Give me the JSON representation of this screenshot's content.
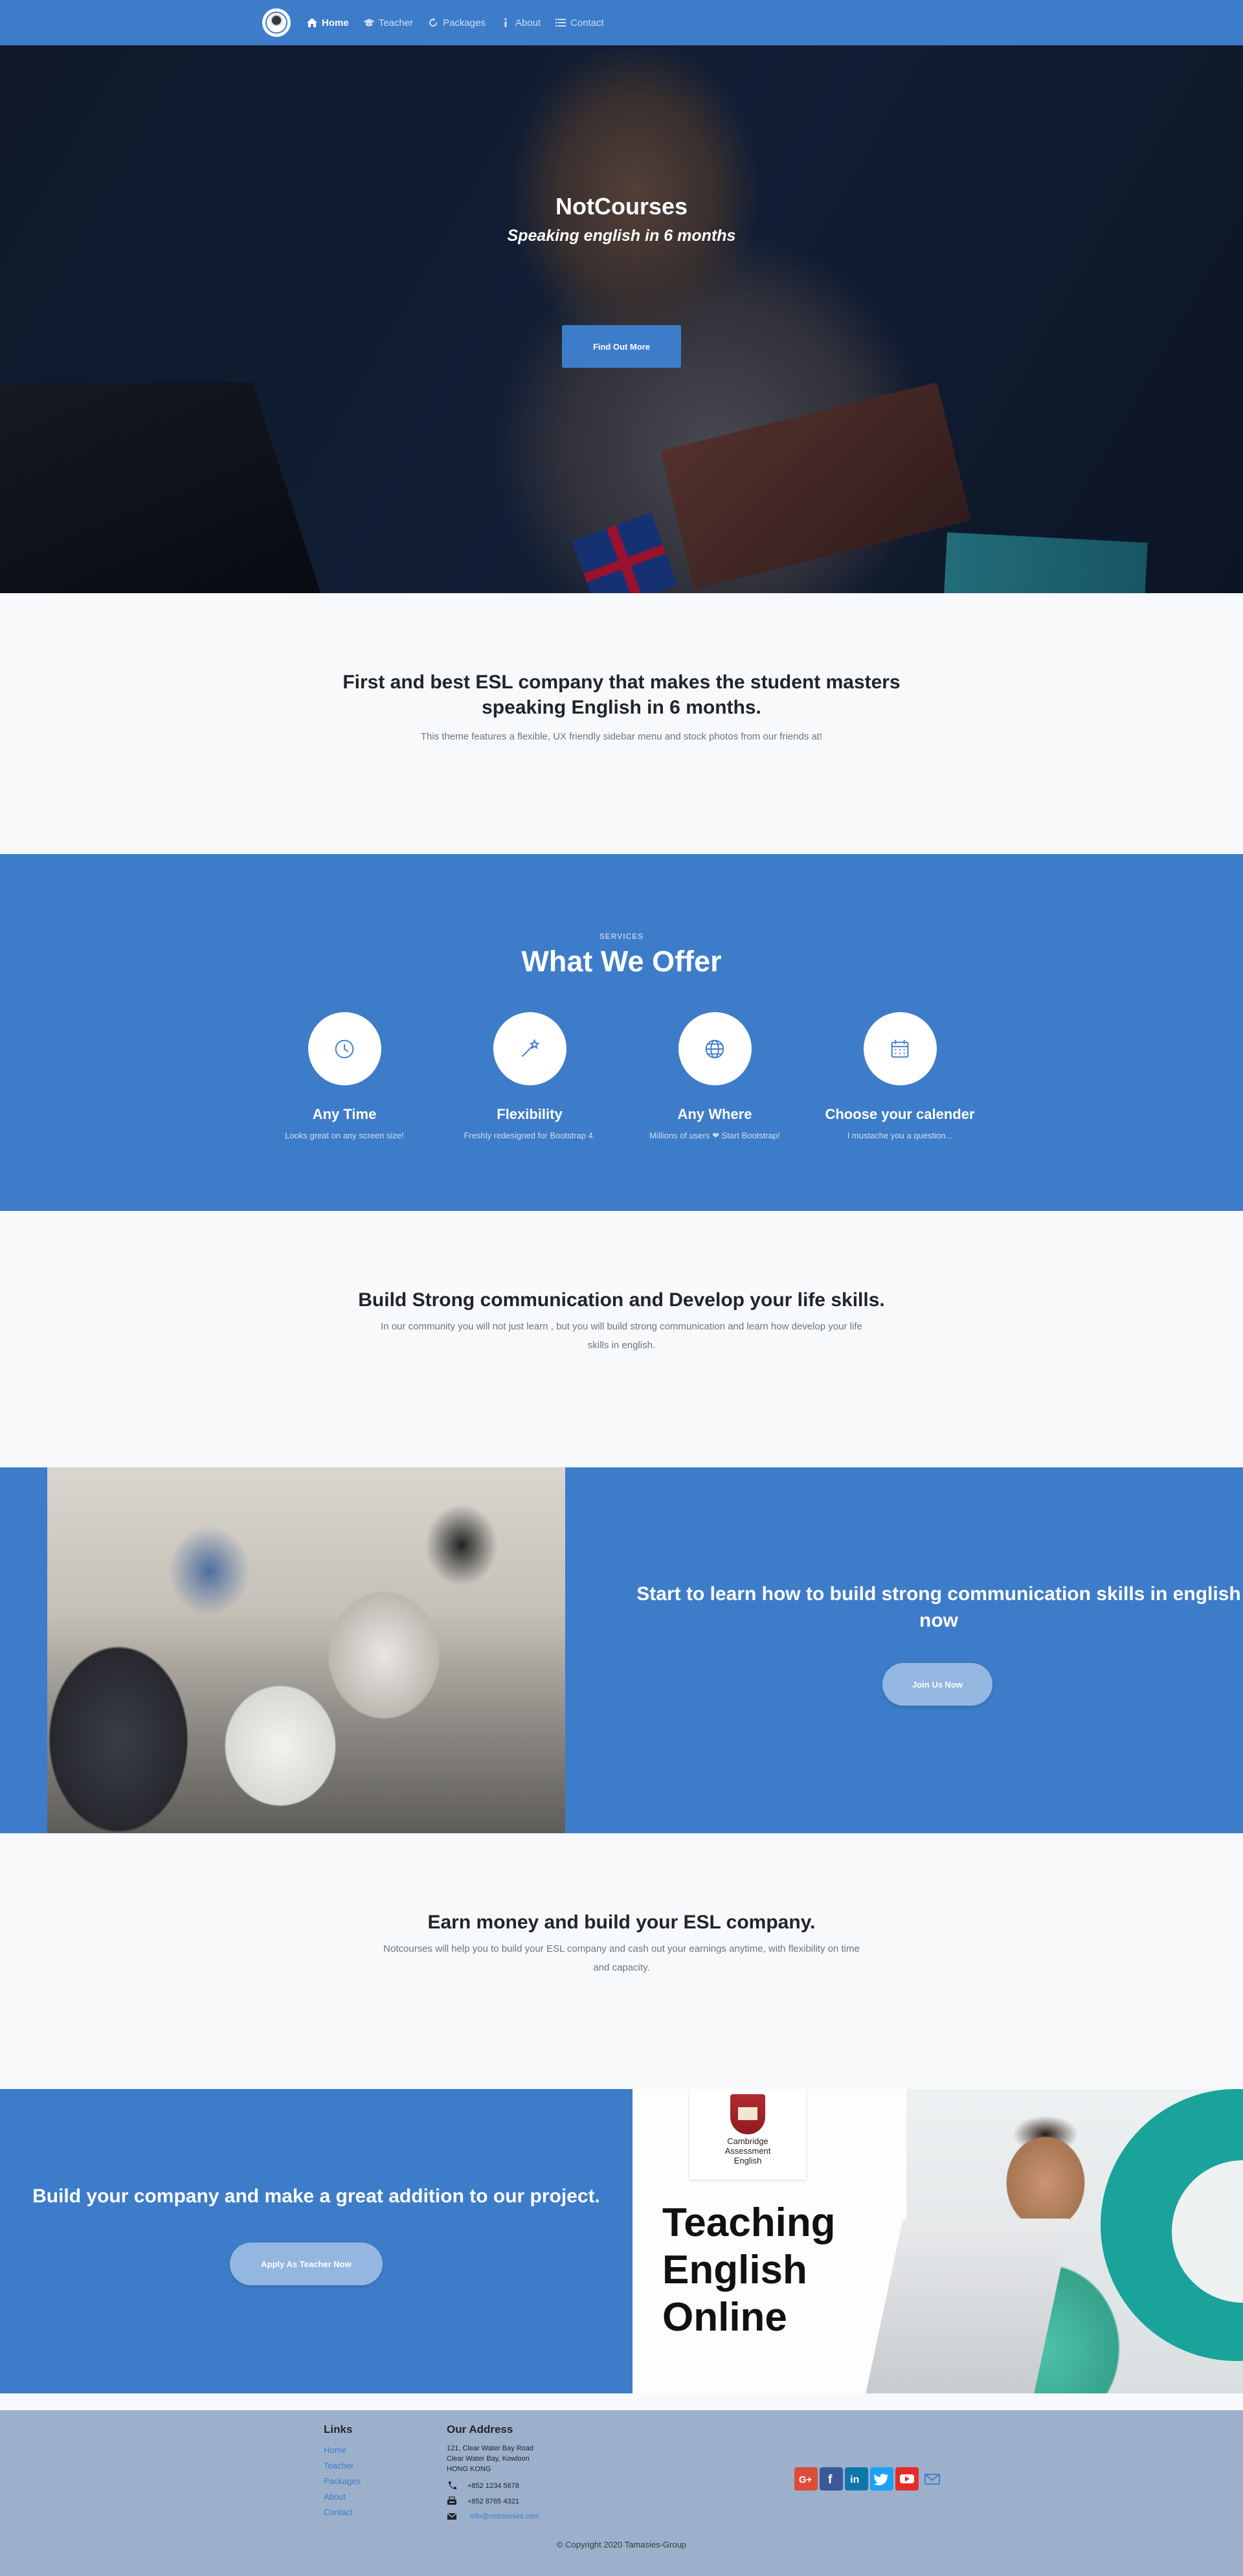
{
  "nav": {
    "items": [
      {
        "label": "Home",
        "icon": "home-icon"
      },
      {
        "label": "Teacher",
        "icon": "graduation-cap-icon"
      },
      {
        "label": "Packages",
        "icon": "refresh-icon"
      },
      {
        "label": "About",
        "icon": "info-icon"
      },
      {
        "label": "Contact",
        "icon": "list-icon"
      }
    ],
    "bg_color": "#3d7cc9"
  },
  "hero": {
    "title": "NotCourses",
    "subtitle": "Speaking english in 6 months",
    "button": "Find Out More"
  },
  "intro": {
    "heading_line1": "First and best ESL company that makes the student masters",
    "heading_line2": "speaking English in 6 months.",
    "text": "This theme features a flexible, UX friendly sidebar menu and stock photos from our friends at!"
  },
  "services": {
    "eyebrow": "SERVICES",
    "title": "What We Offer",
    "items": [
      {
        "title": "Any Time",
        "text": "Looks great on any screen size!",
        "icon": "clock-icon"
      },
      {
        "title": "Flexibility",
        "text": "Freshly redesigned for Bootstrap 4.",
        "icon": "magic-wand-icon"
      },
      {
        "title": "Any Where",
        "text": "Millions of users ❤ Start Bootstrap!",
        "icon": "globe-icon"
      },
      {
        "title": "Choose your calender",
        "text": "I mustache you a question...",
        "icon": "calendar-icon"
      }
    ]
  },
  "communication": {
    "heading": "Build Strong communication and Develop your life skills.",
    "text_line1": "In our community you will not just learn , but you will build strong communication and learn how develop your life",
    "text_line2": "skills in english."
  },
  "learn": {
    "heading_line1": "Start to learn how to build strong communication skills in english",
    "heading_line2": "now",
    "button": "Join Us Now"
  },
  "earn": {
    "heading": "Earn money and build your ESL company.",
    "text_line1": "Notcourses will help you to build your ESL company and cash out your earnings anytime, with flexibility on time",
    "text_line2": "and capacity."
  },
  "company": {
    "heading": "Build your company and make a great addition to our project.",
    "button": "Apply As Teacher Now",
    "image_text_line1": "Teaching",
    "image_text_line2": "English",
    "image_text_line3": "Online",
    "badge_line1": "Cambridge",
    "badge_line2": "Assessment",
    "badge_line3": "English"
  },
  "footer": {
    "links_title": "Links",
    "links": [
      "Home",
      "Teacher",
      "Packages",
      "About",
      "Contact"
    ],
    "address_title": "Our Address",
    "address_line1": "121, Clear Water Bay Road",
    "address_line2": "Clear Water Bay, Kowloon",
    "address_line3": "HONG KONG",
    "phone": "+852 1234 5678",
    "fax": "+852 8765 4321",
    "email": "info@notcourses.com",
    "social": [
      "google-plus-icon",
      "facebook-icon",
      "linkedin-icon",
      "twitter-icon",
      "youtube-icon",
      "mail-icon"
    ],
    "copyright": "© Copyright 2020 Tamasies-Group"
  }
}
